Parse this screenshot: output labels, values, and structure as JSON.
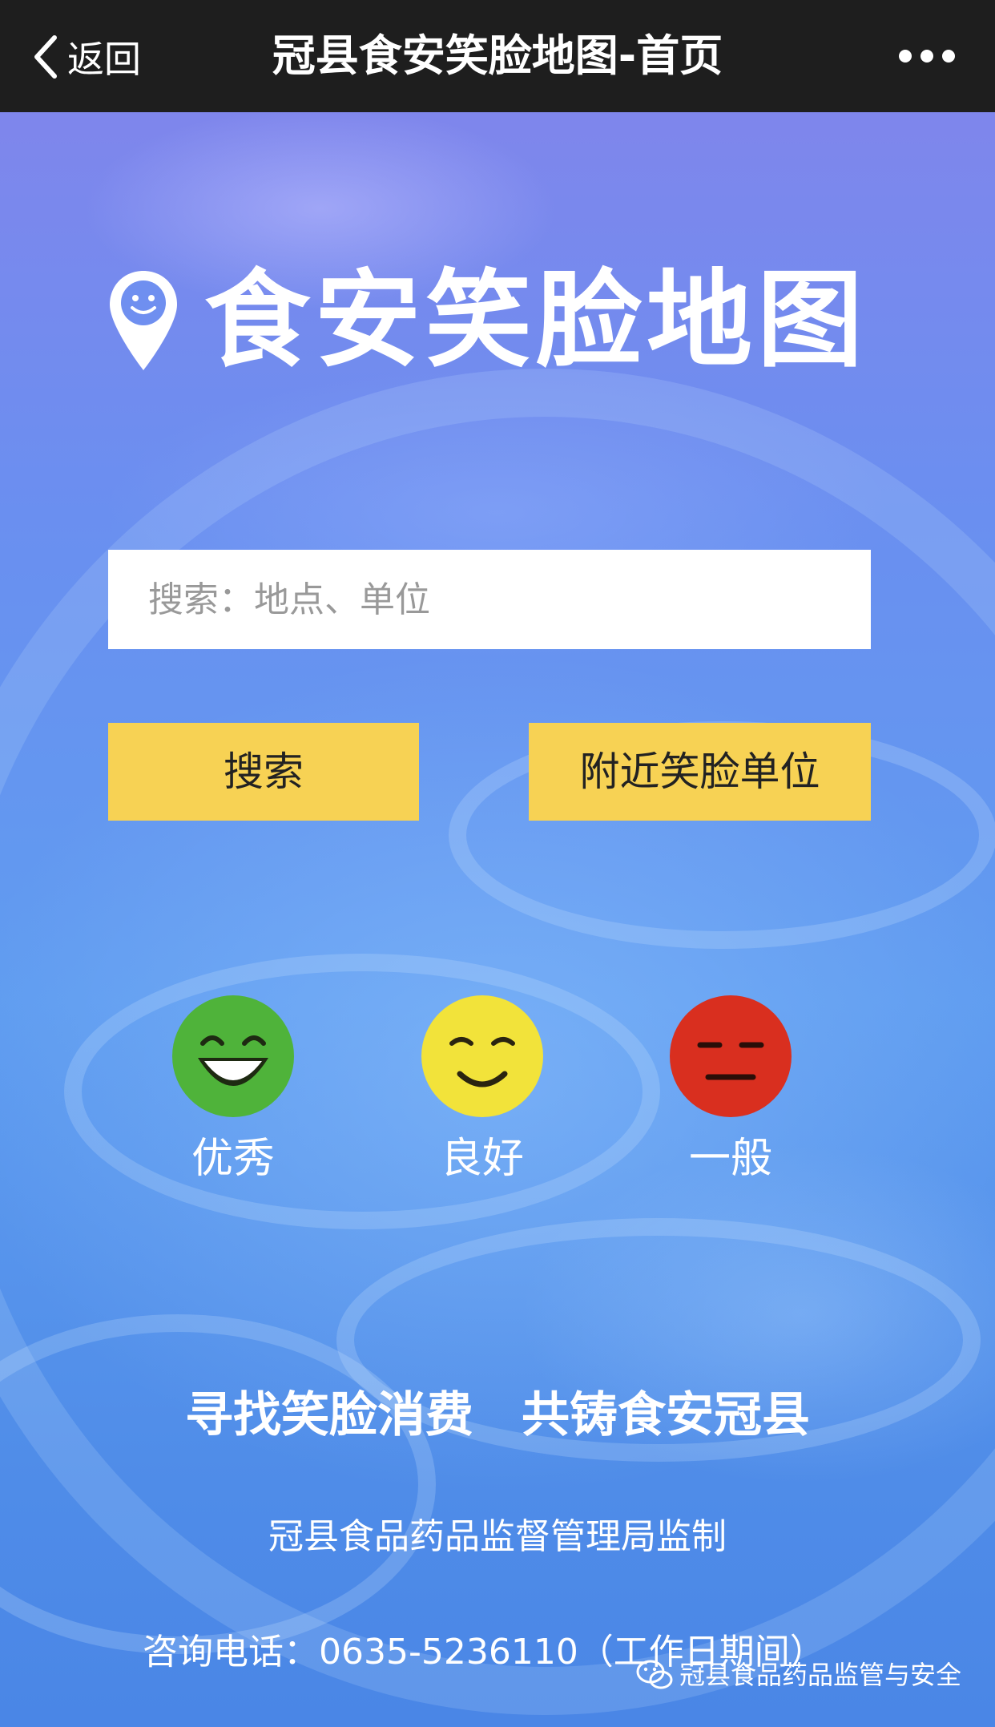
{
  "nav": {
    "back_label": "返回",
    "title": "冠县食安笑脸地图-首页"
  },
  "hero": {
    "logo_text": "食安笑脸地图",
    "search_placeholder": "搜索：地点、单位",
    "search_button": "搜索",
    "nearby_button": "附近笑脸单位",
    "ratings": [
      {
        "label": "优秀",
        "icon": "green-laughing-face-icon",
        "color": "#4fb33a"
      },
      {
        "label": "良好",
        "icon": "yellow-smiling-face-icon",
        "color": "#f2e33a"
      },
      {
        "label": "一般",
        "icon": "red-neutral-face-icon",
        "color": "#d92f1f"
      }
    ],
    "slogan": "寻找笑脸消费　共铸食安冠县",
    "org": "冠县食品药品监督管理局监制",
    "contact": "咨询电话：0635-5236110（工作日期间）"
  },
  "watermark": {
    "text": "冠县食品药品监管与安全",
    "icon": "wechat-icon"
  },
  "colors": {
    "nav_bg": "#1e1e1e",
    "button_yellow": "#f7d254",
    "hero_blue": "#5f9cf0"
  }
}
